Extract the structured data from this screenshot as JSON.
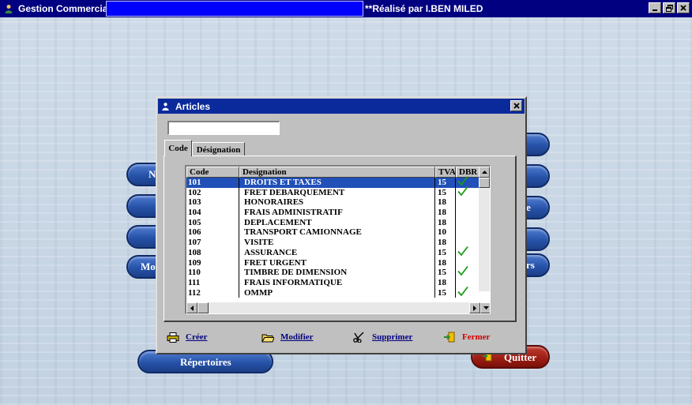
{
  "window": {
    "title": "Gestion Commerciale",
    "credit": "**Réalisé par I.BEN MILED",
    "controls": {
      "minimize": "_",
      "maximize": "🗗",
      "close": "×"
    }
  },
  "background_buttons": {
    "left_labels": [
      "N",
      "Mo"
    ],
    "right_labels": [
      "e",
      "rs"
    ],
    "repertoires": "Répertoires",
    "quitter": "Quitter"
  },
  "dialog": {
    "title": "Articles",
    "close": "×",
    "search": {
      "value": "",
      "placeholder": ""
    },
    "tabs": [
      {
        "label": "Code",
        "active": true
      },
      {
        "label": "Désignation",
        "active": false
      }
    ],
    "grid": {
      "columns": [
        "Code",
        "Designation",
        "TVA",
        "DBR"
      ],
      "rows": [
        {
          "code": "101",
          "designation": "DROITS ET TAXES",
          "tva": "15",
          "dbr": true,
          "selected": true
        },
        {
          "code": "102",
          "designation": "FRET DEBARQUEMENT",
          "tva": "15",
          "dbr": true,
          "selected": false
        },
        {
          "code": "103",
          "designation": "HONORAIRES",
          "tva": "18",
          "dbr": false,
          "selected": false
        },
        {
          "code": "104",
          "designation": "FRAIS ADMINISTRATIF",
          "tva": "18",
          "dbr": false,
          "selected": false
        },
        {
          "code": "105",
          "designation": "DEPLACEMENT",
          "tva": "18",
          "dbr": false,
          "selected": false
        },
        {
          "code": "106",
          "designation": "TRANSPORT  CAMIONNAGE",
          "tva": "10",
          "dbr": false,
          "selected": false
        },
        {
          "code": "107",
          "designation": "VISITE",
          "tva": "18",
          "dbr": false,
          "selected": false
        },
        {
          "code": "108",
          "designation": "ASSURANCE",
          "tva": "15",
          "dbr": true,
          "selected": false
        },
        {
          "code": "109",
          "designation": "FRET URGENT",
          "tva": "18",
          "dbr": false,
          "selected": false
        },
        {
          "code": "110",
          "designation": "TIMBRE DE DIMENSION",
          "tva": "15",
          "dbr": true,
          "selected": false
        },
        {
          "code": "111",
          "designation": "FRAIS INFORMATIQUE",
          "tva": "18",
          "dbr": false,
          "selected": false
        },
        {
          "code": "112",
          "designation": "OMMP",
          "tva": "15",
          "dbr": true,
          "selected": false
        }
      ]
    },
    "actions": {
      "create": "Créer",
      "modify": "Modifier",
      "delete": "Supprimer",
      "close": "Fermer"
    }
  },
  "icons": {
    "app": "person-icon",
    "check": "checkmark-icon",
    "create": "printer-icon",
    "modify": "folder-open-icon",
    "delete": "scissors-icon",
    "close": "exit-door-icon",
    "quit": "exit-door-icon"
  },
  "colors": {
    "titlebar": "#000080",
    "title_highlight": "#0000ff",
    "dialog_titlebar": "#0a2a9c",
    "selection": "#2050b8",
    "action_link": "#000080",
    "danger": "#d00000",
    "check": "#1a9a1a"
  }
}
